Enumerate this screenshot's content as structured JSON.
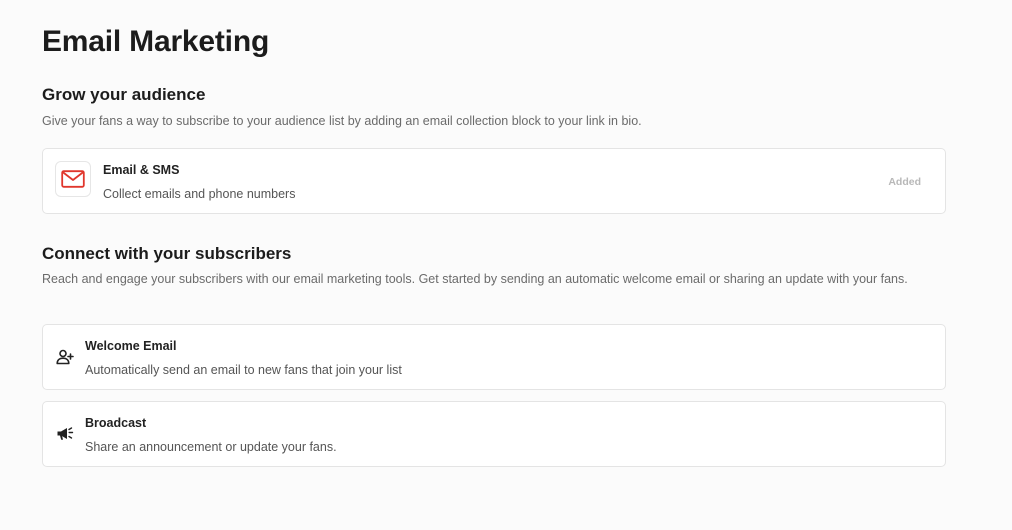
{
  "page": {
    "title": "Email Marketing"
  },
  "grow": {
    "title": "Grow your audience",
    "description": "Give your fans a way to subscribe to your audience list by adding an email collection block to your link in bio.",
    "card": {
      "title": "Email & SMS",
      "subtitle": "Collect emails and phone numbers",
      "status": "Added",
      "icon": "mail-icon",
      "icon_color": "#e0362c"
    }
  },
  "connect": {
    "title": "Connect with your subscribers",
    "description": "Reach and engage your subscribers with our email marketing tools. Get started by sending an automatic welcome email or sharing an update with your fans.",
    "cards": [
      {
        "title": "Welcome Email",
        "subtitle": "Automatically send an email to new fans that join your list",
        "icon": "add-user-icon"
      },
      {
        "title": "Broadcast",
        "subtitle": "Share an announcement or update your fans.",
        "icon": "megaphone-icon"
      }
    ]
  }
}
